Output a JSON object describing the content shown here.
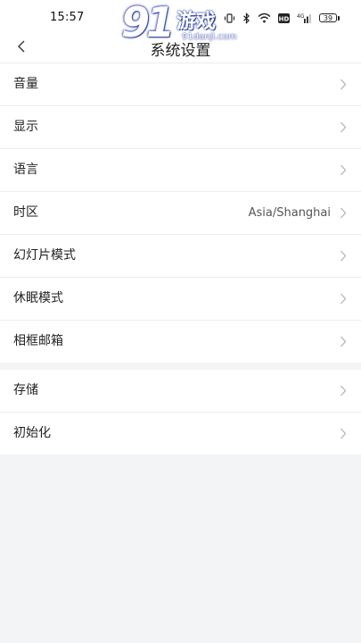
{
  "status_bar": {
    "time": "15:57",
    "battery": "39"
  },
  "watermark": {
    "number": "91",
    "name": "游戏",
    "url": "91danji.com"
  },
  "header": {
    "title": "系统设置"
  },
  "groups": [
    {
      "items": [
        {
          "label": "音量",
          "value": ""
        },
        {
          "label": "显示",
          "value": ""
        },
        {
          "label": "语言",
          "value": ""
        },
        {
          "label": "时区",
          "value": "Asia/Shanghai"
        },
        {
          "label": "幻灯片模式",
          "value": ""
        },
        {
          "label": "休眠模式",
          "value": ""
        },
        {
          "label": "相框邮箱",
          "value": ""
        }
      ]
    },
    {
      "items": [
        {
          "label": "存储",
          "value": ""
        },
        {
          "label": "初始化",
          "value": ""
        }
      ]
    }
  ]
}
